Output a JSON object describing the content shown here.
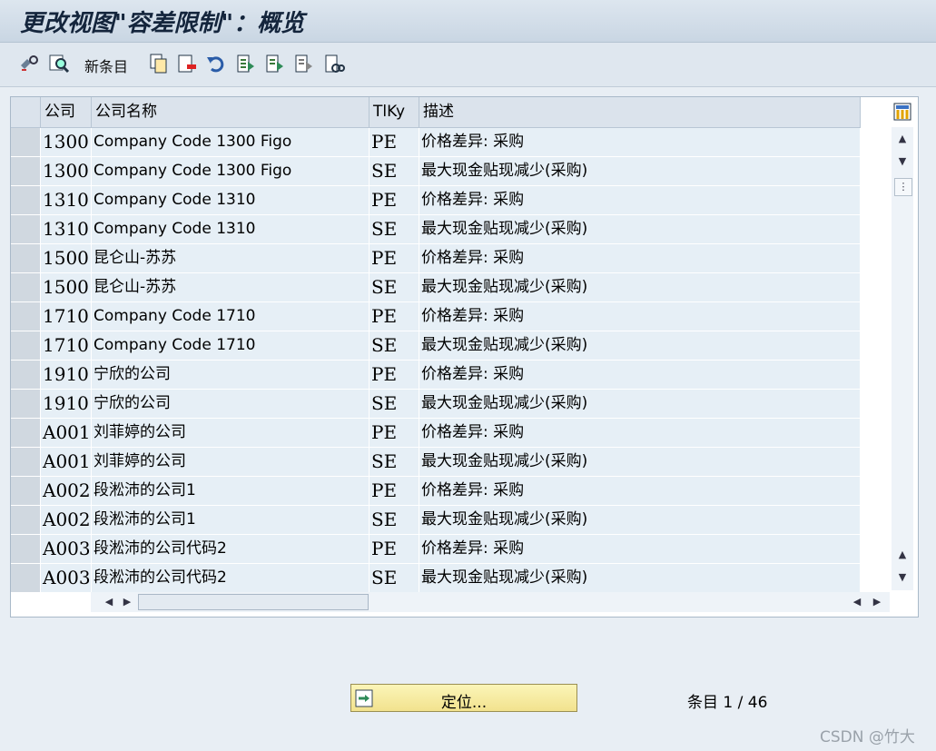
{
  "window": {
    "title": "更改视图\"容差限制\"：概览"
  },
  "toolbar": {
    "new_entries_label": "新条目"
  },
  "table": {
    "columns": [
      "公司",
      "公司名称",
      "TlKy",
      "描述"
    ],
    "rows": [
      {
        "code": "1300",
        "name": "Company Code 1300 Figo",
        "tiky": "PE",
        "desc": "价格差异: 采购"
      },
      {
        "code": "1300",
        "name": "Company Code 1300 Figo",
        "tiky": "SE",
        "desc": "最大现金贴现减少(采购)"
      },
      {
        "code": "1310",
        "name": "Company Code 1310",
        "tiky": "PE",
        "desc": "价格差异: 采购"
      },
      {
        "code": "1310",
        "name": "Company Code 1310",
        "tiky": "SE",
        "desc": "最大现金贴现减少(采购)"
      },
      {
        "code": "1500",
        "name": "昆仑山-苏苏",
        "tiky": "PE",
        "desc": "价格差异: 采购"
      },
      {
        "code": "1500",
        "name": "昆仑山-苏苏",
        "tiky": "SE",
        "desc": "最大现金贴现减少(采购)"
      },
      {
        "code": "1710",
        "name": "Company Code 1710",
        "tiky": "PE",
        "desc": "价格差异: 采购"
      },
      {
        "code": "1710",
        "name": "Company Code 1710",
        "tiky": "SE",
        "desc": "最大现金贴现减少(采购)"
      },
      {
        "code": "1910",
        "name": "宁欣的公司",
        "tiky": "PE",
        "desc": "价格差异: 采购"
      },
      {
        "code": "1910",
        "name": "宁欣的公司",
        "tiky": "SE",
        "desc": "最大现金贴现减少(采购)"
      },
      {
        "code": "A001",
        "name": "刘菲婷的公司",
        "tiky": "PE",
        "desc": "价格差异: 采购"
      },
      {
        "code": "A001",
        "name": "刘菲婷的公司",
        "tiky": "SE",
        "desc": "最大现金贴现减少(采购)"
      },
      {
        "code": "A002",
        "name": "段淞沛的公司1",
        "tiky": "PE",
        "desc": "价格差异: 采购"
      },
      {
        "code": "A002",
        "name": "段淞沛的公司1",
        "tiky": "SE",
        "desc": "最大现金贴现减少(采购)"
      },
      {
        "code": "A003",
        "name": "段淞沛的公司代码2",
        "tiky": "PE",
        "desc": "价格差异: 采购"
      },
      {
        "code": "A003",
        "name": "段淞沛的公司代码2",
        "tiky": "SE",
        "desc": "最大现金贴现减少(采购)"
      }
    ]
  },
  "footer": {
    "position_button": "定位...",
    "entries_label": "条目",
    "entries_value": "1 / 46",
    "watermark": "CSDN @竹大"
  }
}
